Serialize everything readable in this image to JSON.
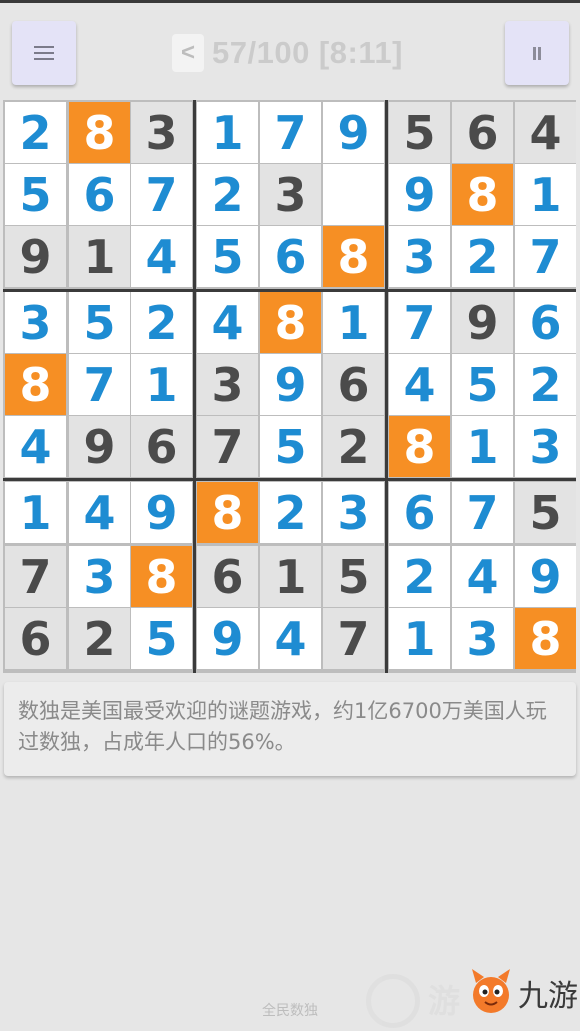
{
  "header": {
    "menu_icon": "menu-list-icon",
    "back_label": "<",
    "progress": "57/100 [8:11]",
    "pause_icon": "pause-icon"
  },
  "board": {
    "rows": [
      [
        {
          "v": "2",
          "t": "user"
        },
        {
          "v": "8",
          "t": "sel"
        },
        {
          "v": "3",
          "t": "given"
        },
        {
          "v": "1",
          "t": "user"
        },
        {
          "v": "7",
          "t": "user"
        },
        {
          "v": "9",
          "t": "user"
        },
        {
          "v": "5",
          "t": "given"
        },
        {
          "v": "6",
          "t": "given"
        },
        {
          "v": "4",
          "t": "given"
        }
      ],
      [
        {
          "v": "5",
          "t": "user"
        },
        {
          "v": "6",
          "t": "user"
        },
        {
          "v": "7",
          "t": "user"
        },
        {
          "v": "2",
          "t": "user"
        },
        {
          "v": "3",
          "t": "given"
        },
        {
          "v": "",
          "t": "empty"
        },
        {
          "v": "9",
          "t": "user"
        },
        {
          "v": "8",
          "t": "sel"
        },
        {
          "v": "1",
          "t": "user"
        }
      ],
      [
        {
          "v": "9",
          "t": "given"
        },
        {
          "v": "1",
          "t": "given"
        },
        {
          "v": "4",
          "t": "user"
        },
        {
          "v": "5",
          "t": "user"
        },
        {
          "v": "6",
          "t": "user"
        },
        {
          "v": "8",
          "t": "sel"
        },
        {
          "v": "3",
          "t": "user"
        },
        {
          "v": "2",
          "t": "user"
        },
        {
          "v": "7",
          "t": "user"
        }
      ],
      [
        {
          "v": "3",
          "t": "user"
        },
        {
          "v": "5",
          "t": "user"
        },
        {
          "v": "2",
          "t": "user"
        },
        {
          "v": "4",
          "t": "user"
        },
        {
          "v": "8",
          "t": "sel"
        },
        {
          "v": "1",
          "t": "user"
        },
        {
          "v": "7",
          "t": "user"
        },
        {
          "v": "9",
          "t": "given"
        },
        {
          "v": "6",
          "t": "user"
        }
      ],
      [
        {
          "v": "8",
          "t": "sel"
        },
        {
          "v": "7",
          "t": "user"
        },
        {
          "v": "1",
          "t": "user"
        },
        {
          "v": "3",
          "t": "given"
        },
        {
          "v": "9",
          "t": "user"
        },
        {
          "v": "6",
          "t": "given"
        },
        {
          "v": "4",
          "t": "user"
        },
        {
          "v": "5",
          "t": "user"
        },
        {
          "v": "2",
          "t": "user"
        }
      ],
      [
        {
          "v": "4",
          "t": "user"
        },
        {
          "v": "9",
          "t": "given"
        },
        {
          "v": "6",
          "t": "given"
        },
        {
          "v": "7",
          "t": "given"
        },
        {
          "v": "5",
          "t": "user"
        },
        {
          "v": "2",
          "t": "given"
        },
        {
          "v": "8",
          "t": "sel"
        },
        {
          "v": "1",
          "t": "user"
        },
        {
          "v": "3",
          "t": "user"
        }
      ],
      [
        {
          "v": "1",
          "t": "user"
        },
        {
          "v": "4",
          "t": "user"
        },
        {
          "v": "9",
          "t": "user"
        },
        {
          "v": "8",
          "t": "sel"
        },
        {
          "v": "2",
          "t": "user"
        },
        {
          "v": "3",
          "t": "user"
        },
        {
          "v": "6",
          "t": "user"
        },
        {
          "v": "7",
          "t": "user"
        },
        {
          "v": "5",
          "t": "given"
        }
      ],
      [
        {
          "v": "7",
          "t": "given"
        },
        {
          "v": "3",
          "t": "user"
        },
        {
          "v": "8",
          "t": "sel"
        },
        {
          "v": "6",
          "t": "given"
        },
        {
          "v": "1",
          "t": "given"
        },
        {
          "v": "5",
          "t": "given"
        },
        {
          "v": "2",
          "t": "user"
        },
        {
          "v": "4",
          "t": "user"
        },
        {
          "v": "9",
          "t": "user"
        }
      ],
      [
        {
          "v": "6",
          "t": "given"
        },
        {
          "v": "2",
          "t": "given"
        },
        {
          "v": "5",
          "t": "user"
        },
        {
          "v": "9",
          "t": "user"
        },
        {
          "v": "4",
          "t": "user"
        },
        {
          "v": "7",
          "t": "given"
        },
        {
          "v": "1",
          "t": "user"
        },
        {
          "v": "3",
          "t": "user"
        },
        {
          "v": "8",
          "t": "sel"
        }
      ]
    ]
  },
  "info_text": "数独是美国最受欢迎的谜题游戏，约1亿6700万美国人玩过数独，占成年人口的56%。",
  "footer_text": "全民数独",
  "watermark": {
    "left_glyph": "游",
    "right_text": "九游"
  },
  "colors": {
    "user_digit": "#1e8cd2",
    "given_digit": "#4b4b4b",
    "highlight": "#f68f24",
    "given_bg": "#e3e3e3"
  }
}
